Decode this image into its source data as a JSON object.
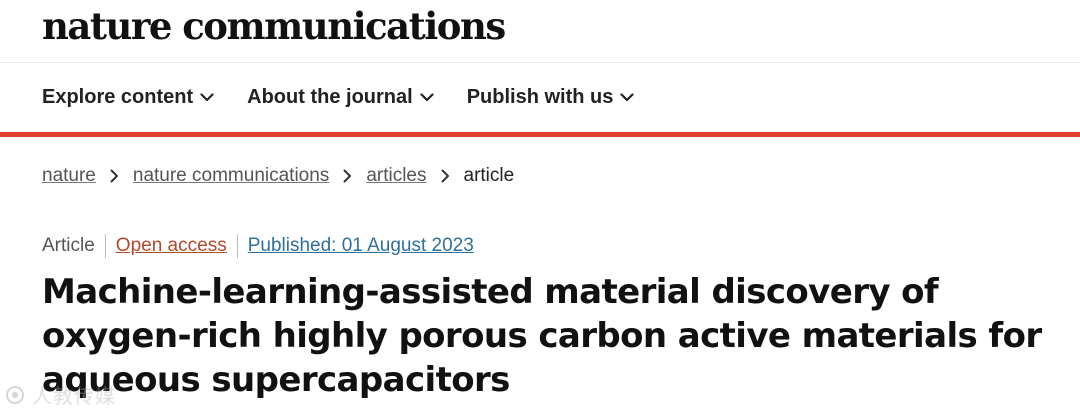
{
  "header": {
    "logo_text": "nature communications"
  },
  "nav": {
    "items": [
      {
        "label": "Explore content"
      },
      {
        "label": "About the journal"
      },
      {
        "label": "Publish with us"
      }
    ]
  },
  "breadcrumb": {
    "items": [
      {
        "label": "nature"
      },
      {
        "label": "nature communications"
      },
      {
        "label": "articles"
      }
    ],
    "current": "article"
  },
  "article": {
    "type": "Article",
    "access": "Open access",
    "published": "Published: 01 August 2023",
    "title": "Machine-learning-assisted material discovery of oxygen-rich highly porous carbon active materials for aqueous supercapacitors"
  },
  "watermark": {
    "text": "人教传媒"
  },
  "colors": {
    "accent_rule": "#e0412e",
    "open_access": "#b04a29",
    "published_link": "#2e6f9c"
  }
}
